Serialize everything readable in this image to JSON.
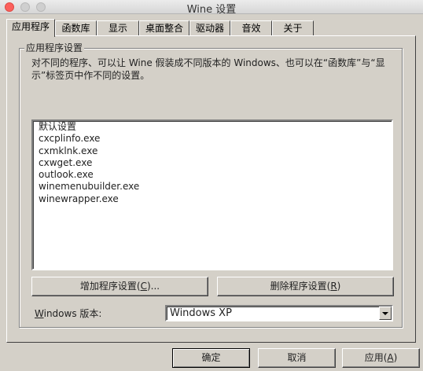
{
  "window": {
    "title": "Wine 设置"
  },
  "tabs": [
    {
      "label": "应用程序"
    },
    {
      "label": "函数库"
    },
    {
      "label": "显示"
    },
    {
      "label": "桌面整合"
    },
    {
      "label": "驱动器"
    },
    {
      "label": "音效"
    },
    {
      "label": "关于"
    }
  ],
  "apps": {
    "group_title": "应用程序设置",
    "description": "对不同的程序、可以让 Wine 假装成不同版本的 Windows、也可以在“函数库”与“显示”标签页中作不同的设置。",
    "list": [
      {
        "label": "默认设置",
        "selected": true
      },
      {
        "label": "cxcplinfo.exe"
      },
      {
        "label": "cxmklnk.exe"
      },
      {
        "label": "cxwget.exe"
      },
      {
        "label": "outlook.exe"
      },
      {
        "label": "winemenubuilder.exe"
      },
      {
        "label": "winewrapper.exe"
      }
    ],
    "add_button": {
      "prefix": "增加程序设置(",
      "key": "C",
      "suffix": ")..."
    },
    "remove_button": {
      "prefix": "删除程序设置(",
      "key": "R",
      "suffix": ")"
    },
    "version_label": {
      "key": "W",
      "rest": "indows 版本:"
    },
    "version_value": "Windows XP"
  },
  "footer": {
    "ok": "确定",
    "cancel": "取消",
    "apply": {
      "prefix": "应用(",
      "key": "A",
      "suffix": ")"
    }
  }
}
